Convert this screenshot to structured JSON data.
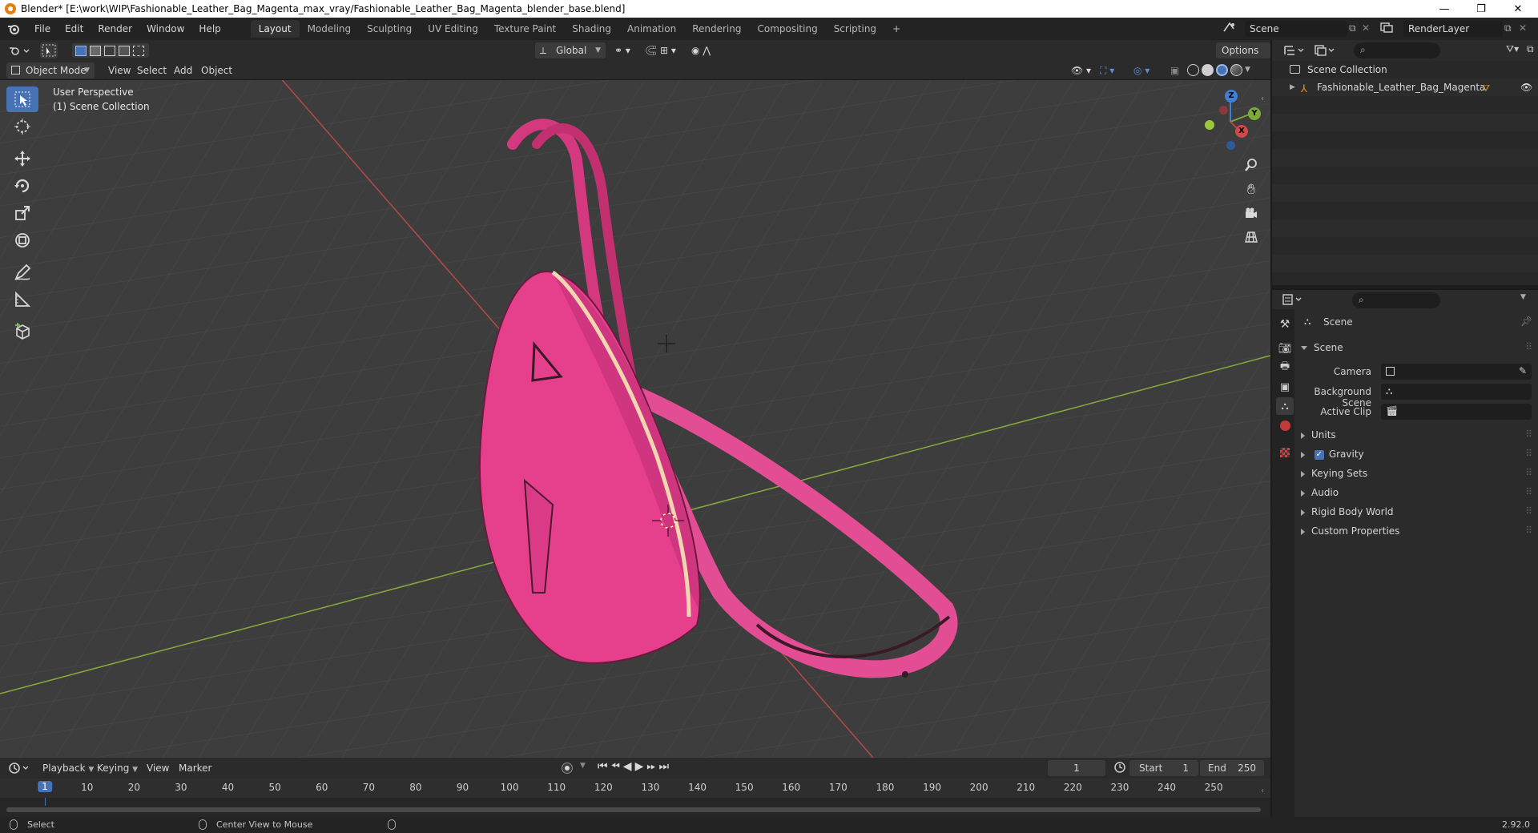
{
  "window": {
    "title": "Blender* [E:\\work\\WIP\\Fashionable_Leather_Bag_Magenta_max_vray/Fashionable_Leather_Bag_Magenta_blender_base.blend]",
    "minimize": "—",
    "maximize": "❐",
    "close": "✕"
  },
  "menu": {
    "items": [
      "File",
      "Edit",
      "Render",
      "Window",
      "Help"
    ]
  },
  "workspaces": {
    "tabs": [
      "Layout",
      "Modeling",
      "Sculpting",
      "UV Editing",
      "Texture Paint",
      "Shading",
      "Animation",
      "Rendering",
      "Compositing",
      "Scripting"
    ],
    "active": "Layout",
    "add": "+"
  },
  "scene_selector": {
    "value": "Scene"
  },
  "layer_selector": {
    "value": "RenderLayer"
  },
  "viewport_header": {
    "transform_orientation": "Global",
    "options": "Options"
  },
  "viewport_header2": {
    "mode": "Object Mode",
    "menus": [
      "View",
      "Select",
      "Add",
      "Object"
    ]
  },
  "viewport": {
    "perspective": "User Perspective",
    "collection": "(1) Scene Collection",
    "gizmo": {
      "x": "X",
      "y": "Y",
      "z": "Z"
    },
    "colors": {
      "background": "#3d3d3d",
      "x_axis": "#c0403f",
      "y_axis": "#7da83a",
      "bag": "#e63f8c"
    }
  },
  "timeline": {
    "menus": [
      "Playback",
      "Keying",
      "View",
      "Marker"
    ],
    "current_frame": "1",
    "start_label": "Start",
    "start_value": "1",
    "end_label": "End",
    "end_value": "250",
    "frame_marks": [
      "1",
      "10",
      "20",
      "30",
      "40",
      "50",
      "60",
      "70",
      "80",
      "90",
      "100",
      "110",
      "120",
      "130",
      "140",
      "150",
      "160",
      "170",
      "180",
      "190",
      "200",
      "210",
      "220",
      "230",
      "240",
      "250"
    ]
  },
  "statusbar": {
    "select": "Select",
    "center_view": "Center View to Mouse",
    "version": "2.92.0"
  },
  "outliner": {
    "root": "Scene Collection",
    "items": [
      {
        "name": "Fashionable_Leather_Bag_Magenta"
      }
    ]
  },
  "properties": {
    "context": "Scene",
    "panel_title": "Scene",
    "fields": [
      {
        "label": "Camera"
      },
      {
        "label": "Background Scene"
      },
      {
        "label": "Active Clip"
      }
    ],
    "subpanels": [
      {
        "label": "Units",
        "checkbox": false
      },
      {
        "label": "Gravity",
        "checkbox": true
      },
      {
        "label": "Keying Sets",
        "checkbox": false
      },
      {
        "label": "Audio",
        "checkbox": false
      },
      {
        "label": "Rigid Body World",
        "checkbox": false
      },
      {
        "label": "Custom Properties",
        "checkbox": false
      }
    ]
  }
}
